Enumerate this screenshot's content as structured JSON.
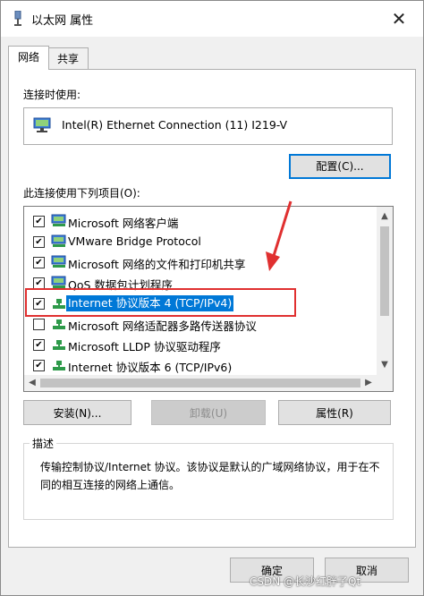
{
  "window": {
    "title": "以太网 属性",
    "close_glyph": "✕"
  },
  "tabs": [
    {
      "label": "网络",
      "active": true
    },
    {
      "label": "共享",
      "active": false
    }
  ],
  "connect_using_label": "连接时使用:",
  "adapter": {
    "name": "Intel(R) Ethernet Connection (11) I219-V",
    "icon": "network-adapter-icon"
  },
  "configure_button": "配置(C)...",
  "items_label": "此连接使用下列项目(O):",
  "items": [
    {
      "label": "Microsoft 网络客户端",
      "checked": true,
      "icon": "network-client-icon"
    },
    {
      "label": "VMware Bridge Protocol",
      "checked": true,
      "icon": "network-service-icon"
    },
    {
      "label": "Microsoft 网络的文件和打印机共享",
      "checked": true,
      "icon": "network-service-icon"
    },
    {
      "label": "QoS 数据包计划程序",
      "checked": true,
      "icon": "network-service-icon"
    },
    {
      "label": "Internet 协议版本 4 (TCP/IPv4)",
      "checked": true,
      "selected": true,
      "icon": "protocol-icon"
    },
    {
      "label": "Microsoft 网络适配器多路传送器协议",
      "checked": false,
      "icon": "protocol-icon"
    },
    {
      "label": "Microsoft LLDP 协议驱动程序",
      "checked": true,
      "icon": "protocol-icon"
    },
    {
      "label": "Internet 协议版本 6 (TCP/IPv6)",
      "checked": true,
      "icon": "protocol-icon"
    }
  ],
  "buttons": {
    "install": "安装(N)...",
    "uninstall": "卸载(U)",
    "properties": "属性(R)"
  },
  "description": {
    "title": "描述",
    "text": "传输控制协议/Internet 协议。该协议是默认的广域网络协议，用于在不同的相互连接的网络上通信。"
  },
  "footer": {
    "ok": "确定",
    "cancel": "取消"
  },
  "watermark": "CSDN @长沙红胖子Qt",
  "colors": {
    "selection": "#0078d7",
    "annotation": "#e03030",
    "focus": "#0078d7"
  }
}
